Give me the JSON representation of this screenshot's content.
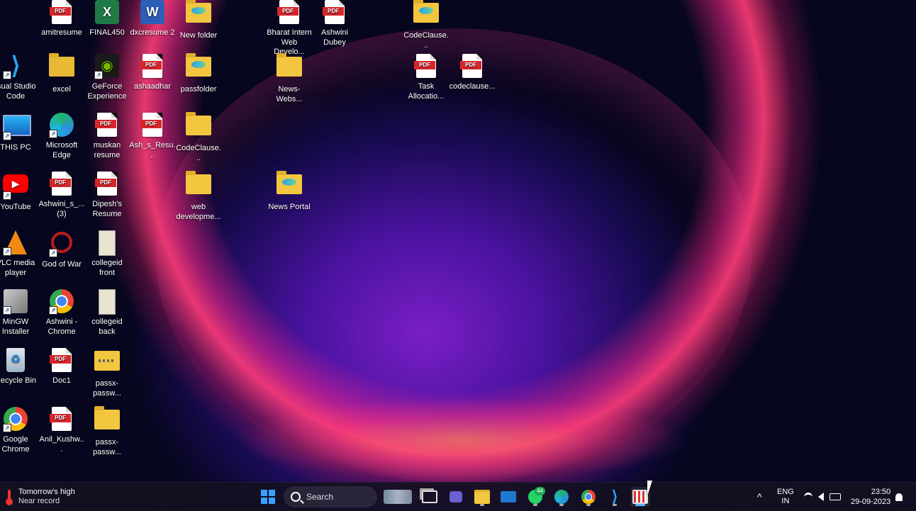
{
  "desktop": {
    "icons": [
      {
        "label": "amitresume",
        "type": "pdf"
      },
      {
        "label": "FINAL450",
        "type": "excel"
      },
      {
        "label": "dxcresume 2",
        "type": "word"
      },
      {
        "label": "New folder",
        "type": "folder"
      },
      {
        "label": "Bharat Intern Web Develo...",
        "type": "pdf"
      },
      {
        "label": "Ashwini Dubey",
        "type": "pdf"
      },
      {
        "label": "CodeClause...",
        "type": "folder"
      },
      {
        "label": "isual Studio Code",
        "type": "vscode"
      },
      {
        "label": "excel",
        "type": "folder"
      },
      {
        "label": "GeForce Experience",
        "type": "nvidia"
      },
      {
        "label": "ashaadhar",
        "type": "pdf"
      },
      {
        "label": "passfolder",
        "type": "folder"
      },
      {
        "label": "News-Webs...",
        "type": "folder"
      },
      {
        "label": "Task Allocatio...",
        "type": "pdf"
      },
      {
        "label": "codeclause...",
        "type": "pdf"
      },
      {
        "label": "THIS PC",
        "type": "monitor"
      },
      {
        "label": "Microsoft Edge",
        "type": "edge"
      },
      {
        "label": "muskan resume",
        "type": "pdf"
      },
      {
        "label": "Ash_s_Resu...",
        "type": "pdf"
      },
      {
        "label": "CodeClause...",
        "type": "folder"
      },
      {
        "label": "YouTube",
        "type": "youtube"
      },
      {
        "label": "Ashwini_s_... (3)",
        "type": "pdf"
      },
      {
        "label": "Dipesh's Resume",
        "type": "pdf"
      },
      {
        "label": "web developme...",
        "type": "folder"
      },
      {
        "label": "News Portal",
        "type": "folder"
      },
      {
        "label": "VLC media player",
        "type": "vlc"
      },
      {
        "label": "God of War",
        "type": "gow"
      },
      {
        "label": "collegeid front",
        "type": "card"
      },
      {
        "label": "MinGW Installer",
        "type": "mingw"
      },
      {
        "label": "Ashwini - Chrome",
        "type": "chrome"
      },
      {
        "label": "collegeid back",
        "type": "card"
      },
      {
        "label": "Recycle Bin",
        "type": "recycle"
      },
      {
        "label": "Doc1",
        "type": "pdf"
      },
      {
        "label": "passx-passw...",
        "type": "zip"
      },
      {
        "label": "Google Chrome",
        "type": "chrome"
      },
      {
        "label": "Anil_Kushw...",
        "type": "pdf"
      },
      {
        "label": "passx-passw...",
        "type": "folder"
      }
    ]
  },
  "icon_glyphs": {
    "pdf_tag": "PDF",
    "word_letter": "W",
    "excel_letter": "X",
    "youtube_play": "▶",
    "recycle_symbol": "♻",
    "shortcut_arrow": "↗"
  },
  "taskbar": {
    "weather_line1": "Tomorrow's high",
    "weather_line2": "Near record",
    "search_label": "Search",
    "whatsapp_badge": "44",
    "lang_line1": "ENG",
    "lang_line2": "IN",
    "time": "23:50",
    "date": "29-09-2023",
    "tray_chevron": "^",
    "accent": "#5fb2ff"
  }
}
